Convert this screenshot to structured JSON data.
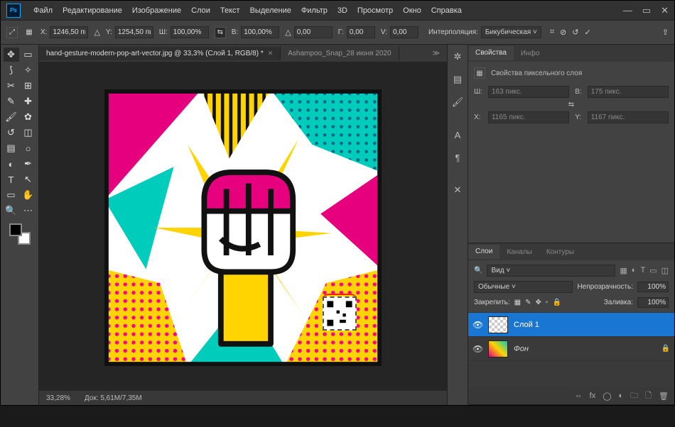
{
  "menu": {
    "file": "Файл",
    "edit": "Редактирование",
    "image": "Изображение",
    "layers": "Слои",
    "type": "Текст",
    "select": "Выделение",
    "filter": "Фильтр",
    "threed": "3D",
    "view": "Просмотр",
    "window": "Окно",
    "help": "Справка"
  },
  "options": {
    "x_label": "X:",
    "x_value": "1246,50 пи",
    "y_label": "Y:",
    "y_value": "1254,50 пи",
    "w_label": "Ш:",
    "w_value": "100,00%",
    "h_label": "В:",
    "h_value": "100,00%",
    "angle_value": "0,00",
    "hskew_label": "Г:",
    "hskew_value": "0,00",
    "vskew_label": "V:",
    "vskew_value": "0,00",
    "interp_label": "Интерполяция:",
    "interp_value": "Бикубическая"
  },
  "tabs": {
    "active": "hand-gesture-modern-pop-art-vector.jpg @ 33,3% (Слой 1, RGB/8) *",
    "inactive": "Ashampoo_Snap_28 июня 2020"
  },
  "status": {
    "zoom": "33,28%",
    "doc_label": "Док:",
    "doc_value": "5,61M/7,35M"
  },
  "properties": {
    "tab_props": "Свойства",
    "tab_info": "Инфо",
    "header": "Свойства пиксельного слоя",
    "w_label": "Ш:",
    "w": "163 пикс.",
    "h_label": "В:",
    "h": "175 пикс.",
    "x_label": "X:",
    "x": "1165 пикс.",
    "y_label": "Y:",
    "y": "1167 пикс."
  },
  "layers_panel": {
    "tab_layers": "Слои",
    "tab_channels": "Каналы",
    "tab_paths": "Контуры",
    "filter_label": "Вид",
    "blend_mode": "Обычные",
    "opacity_label": "Непрозрачность:",
    "opacity": "100%",
    "lock_label": "Закрепить:",
    "fill_label": "Заливка:",
    "fill": "100%",
    "layer1": "Слой 1",
    "layer_bg": "Фон"
  }
}
